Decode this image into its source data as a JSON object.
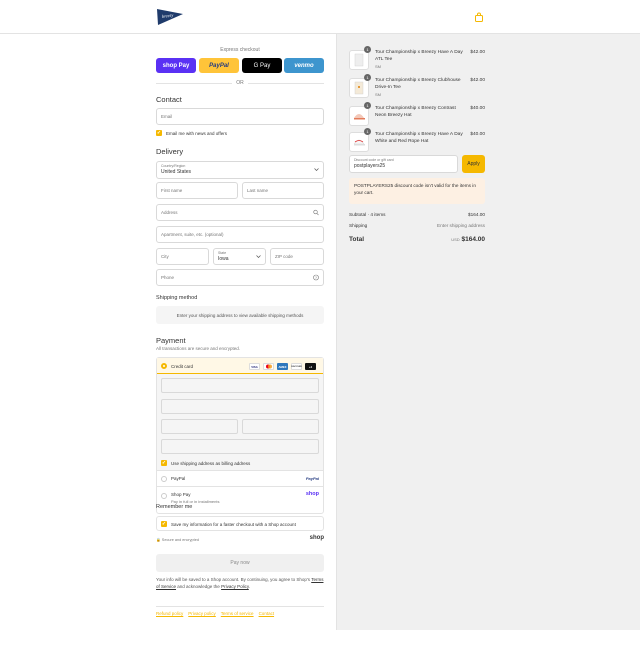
{
  "header": {
    "logo_text": "breezy"
  },
  "express": {
    "title": "Express checkout",
    "shop_pay": "shop Pay",
    "paypal": "PayPal",
    "gpay": "G Pay",
    "venmo": "venmo",
    "or": "OR"
  },
  "contact": {
    "heading": "Contact",
    "email_placeholder": "Email",
    "newsletter_label": "Email me with news and offers"
  },
  "delivery": {
    "heading": "Delivery",
    "country_label": "Country/Region",
    "country_value": "United States",
    "first_name": "First name",
    "last_name": "Last name",
    "address": "Address",
    "apartment": "Apartment, suite, etc. (optional)",
    "city": "City",
    "state_label": "State",
    "state_value": "Iowa",
    "zip": "ZIP code",
    "phone": "Phone"
  },
  "shipping_method": {
    "heading": "Shipping method",
    "message": "Enter your shipping address to view available shipping methods"
  },
  "payment": {
    "heading": "Payment",
    "subtitle": "All transactions are secure and encrypted.",
    "credit_card": "Credit card",
    "card_icons": [
      "VISA",
      "MC",
      "AMEX",
      "DISCOVER",
      "+4"
    ],
    "billing_label": "Use shipping address as billing address",
    "paypal_label": "PayPal",
    "paypal_logo": "PayPal",
    "shoppay_label": "Shop Pay",
    "shoppay_sub": "Pay in full or in installments",
    "shoppay_logo": "shop"
  },
  "remember": {
    "heading": "Remember me",
    "save_label": "Save my information for a faster checkout with a Shop account",
    "secure": "Secure and encrypted",
    "shop_logo": "shop"
  },
  "pay_now": "Pay now",
  "legal": {
    "pre": "Your info will be saved to a Shop account. By continuing, you agree to Shop's",
    "tos": "Terms of Service",
    "mid": "and acknowledge the",
    "privacy": "Privacy Policy",
    "end": "."
  },
  "footer_links": [
    "Refund policy",
    "Privacy policy",
    "Terms of service",
    "Contact"
  ],
  "cart": {
    "items": [
      {
        "qty": "1",
        "name": "Tour Championship x Breezy Have A Day ATL Tee",
        "variant": "SM",
        "price": "$42.00"
      },
      {
        "qty": "1",
        "name": "Tour Championship x Breezy Clubhouse Drive-In Tee",
        "variant": "SM",
        "price": "$42.00"
      },
      {
        "qty": "1",
        "name": "Tour Championship x Breezy Contrast Neon Breezy Hat",
        "variant": "",
        "price": "$40.00"
      },
      {
        "qty": "1",
        "name": "Tour Championship x Breezy Have A Day White and Red Rope Hat",
        "variant": "",
        "price": "$40.00"
      }
    ],
    "discount_label": "Discount code or gift card",
    "discount_value": "postplayers25",
    "apply": "Apply",
    "alert": "POSTPLAYERS25 discount code isn't valid for the items in your cart.",
    "subtotal_label": "Subtotal · 4 items",
    "subtotal_value": "$164.00",
    "shipping_label": "Shipping",
    "shipping_value": "Enter shipping address",
    "total_label": "Total",
    "currency": "USD",
    "total_value": "$164.00"
  },
  "colors": {
    "accent": "#f5b800",
    "shop_purple": "#5a31f4",
    "alert_bg": "#fdf0e3"
  }
}
